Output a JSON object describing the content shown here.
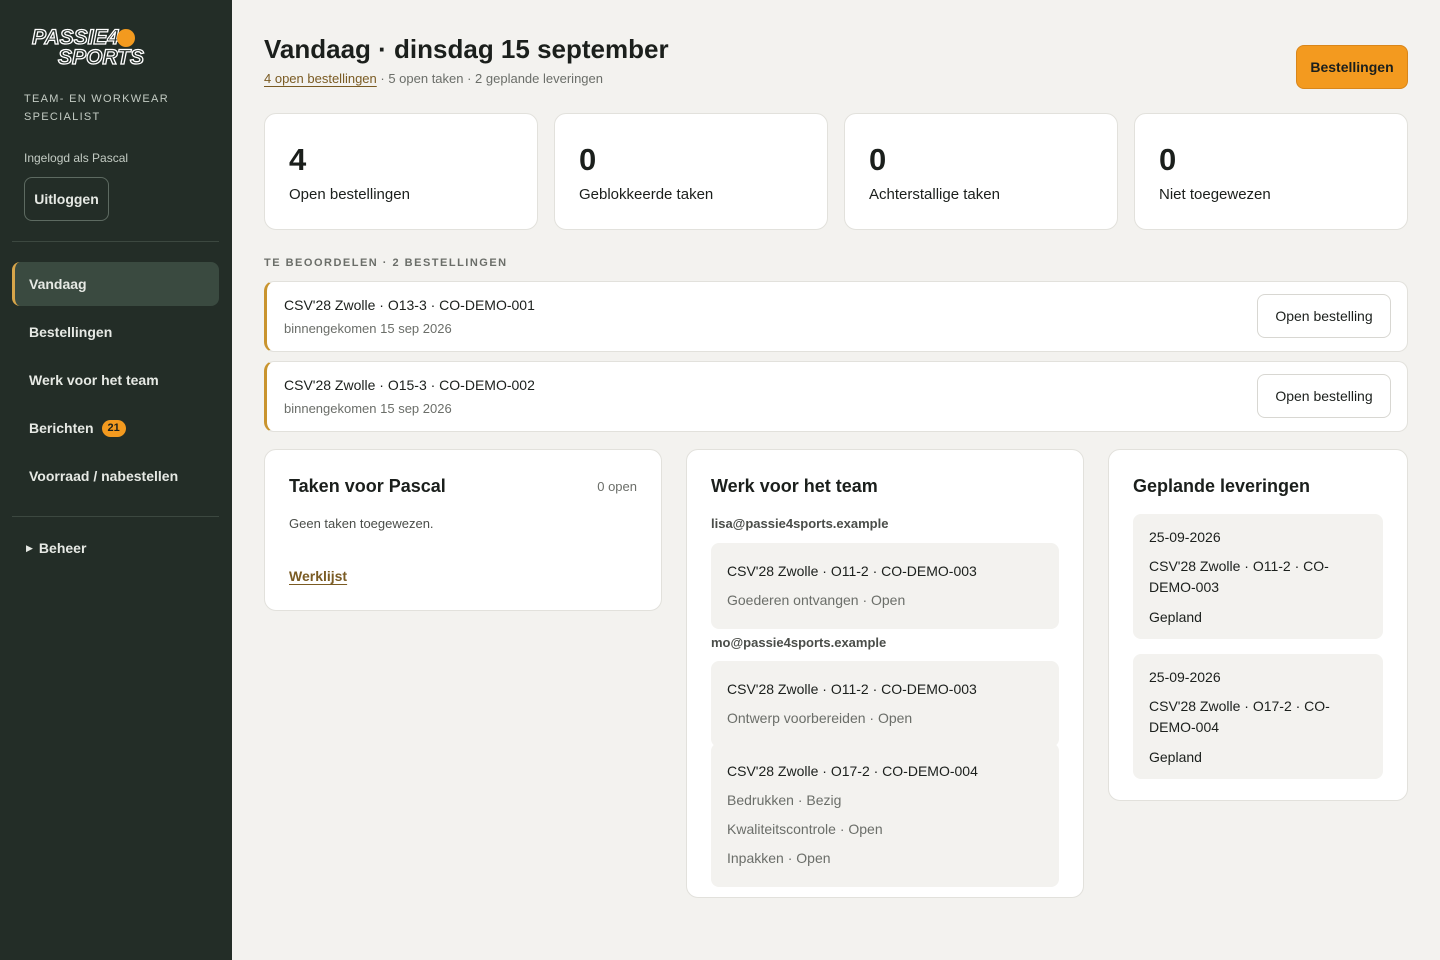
{
  "brand": {
    "logo_line1": "PASSIE4",
    "logo_line2": "SPORTS",
    "tagline": "Team- en workwear specialist"
  },
  "user": {
    "logged_in_text": "Ingelogd als Pascal",
    "logout_label": "Uitloggen"
  },
  "nav": {
    "items": [
      {
        "label": "Vandaag"
      },
      {
        "label": "Bestellingen"
      },
      {
        "label": "Werk voor het team"
      },
      {
        "label": "Berichten",
        "badge": "21"
      },
      {
        "label": "Voorraad / nabestellen"
      }
    ],
    "beheer_label": "Beheer"
  },
  "header": {
    "title": "Vandaag · dinsdag 15 september",
    "subtitle_link": "4 open bestellingen",
    "subtitle_rest": " · 5 open taken · 2 geplande leveringen",
    "orders_button": "Bestellingen"
  },
  "stats": [
    {
      "value": "4",
      "label": "Open bestellingen"
    },
    {
      "value": "0",
      "label": "Geblokkeerde taken"
    },
    {
      "value": "0",
      "label": "Achterstallige taken"
    },
    {
      "value": "0",
      "label": "Niet toegewezen"
    }
  ],
  "review": {
    "label": "Te beoordelen · 2 bestellingen",
    "items": [
      {
        "title": "CSV'28 Zwolle · O13-3 · CO-DEMO-001",
        "received": "binnengekomen 15 sep 2026",
        "button": "Open bestelling"
      },
      {
        "title": "CSV'28 Zwolle · O15-3 · CO-DEMO-002",
        "received": "binnengekomen 15 sep 2026",
        "button": "Open bestelling"
      }
    ]
  },
  "tasks_panel": {
    "title": "Taken voor Pascal",
    "count": "0 open",
    "empty": "Geen taken toegewezen.",
    "link": "Werklijst"
  },
  "team_panel": {
    "title": "Werk voor het team",
    "groups": [
      {
        "email": "lisa@passie4sports.example",
        "items": [
          {
            "title": "CSV'28 Zwolle · O11-2 · CO-DEMO-003",
            "steps": [
              "Goederen ontvangen · Open"
            ]
          }
        ]
      },
      {
        "email": "mo@passie4sports.example",
        "items": [
          {
            "title": "CSV'28 Zwolle · O11-2 · CO-DEMO-003",
            "steps": [
              "Ontwerp voorbereiden · Open"
            ]
          },
          {
            "title": "CSV'28 Zwolle · O17-2 · CO-DEMO-004",
            "steps": [
              "Bedrukken · Bezig",
              "Kwaliteitscontrole · Open",
              "Inpakken · Open"
            ]
          }
        ]
      }
    ]
  },
  "deliveries_panel": {
    "title": "Geplande leveringen",
    "items": [
      {
        "date": "25-09-2026",
        "title": "CSV'28 Zwolle · O11-2 · CO-DEMO-003",
        "status": "Gepland"
      },
      {
        "date": "25-09-2026",
        "title": "CSV'28 Zwolle · O17-2 · CO-DEMO-004",
        "status": "Gepland"
      }
    ]
  },
  "colors": {
    "sidebar_bg": "#232d27",
    "accent_orange": "#f39a1f",
    "accent_gold": "#c9942e",
    "page_bg": "#f3f2ef"
  }
}
